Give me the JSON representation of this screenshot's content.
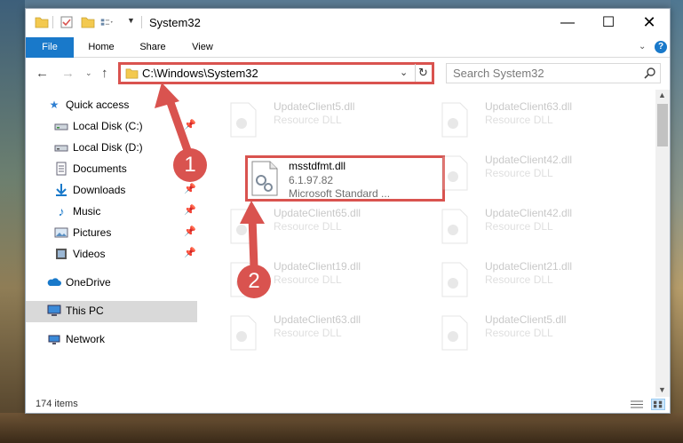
{
  "window": {
    "title": "System32",
    "controls": {
      "minimize": "—",
      "maximize": "☐",
      "close": "✕"
    }
  },
  "ribbon": {
    "tabs": [
      "File",
      "Home",
      "Share",
      "View"
    ],
    "help": "?"
  },
  "address_bar": {
    "path": "C:\\Windows\\System32",
    "dropdown": "⌄",
    "refresh": "↻"
  },
  "search": {
    "placeholder": "Search System32",
    "icon": "search-icon"
  },
  "sidebar": {
    "quick_access": "Quick access",
    "items": [
      {
        "label": "Local Disk (C:)",
        "icon": "drive-icon",
        "pinned": true
      },
      {
        "label": "Local Disk (D:)",
        "icon": "drive-icon",
        "pinned": false
      },
      {
        "label": "Documents",
        "icon": "documents-icon",
        "pinned": true
      },
      {
        "label": "Downloads",
        "icon": "download-icon",
        "pinned": true
      },
      {
        "label": "Music",
        "icon": "music-icon",
        "pinned": true
      },
      {
        "label": "Pictures",
        "icon": "pictures-icon",
        "pinned": true
      },
      {
        "label": "Videos",
        "icon": "videos-icon",
        "pinned": true
      }
    ],
    "onedrive": "OneDrive",
    "this_pc": "This PC",
    "network": "Network"
  },
  "files": {
    "highlighted": {
      "name": "msstdfmt.dll",
      "version": "6.1.97.82",
      "description": "Microsoft Standard ..."
    },
    "left_column": [
      {
        "name": "UpdateClient5.dll",
        "type": "Resource DLL"
      },
      {
        "name": "UpdateClient65.dll",
        "type": "Resource DLL"
      },
      {
        "name": "UpdateClient19.dll",
        "type": "Resource DLL"
      },
      {
        "name": "UpdateClient63.dll",
        "type": "Resource DLL"
      }
    ],
    "right_column": [
      {
        "name": "UpdateClient63.dll",
        "type": "Resource DLL"
      },
      {
        "name": "UpdateClient42.dll",
        "type": "Resource DLL"
      },
      {
        "name": "UpdateClient42.dll",
        "type": "Resource DLL"
      },
      {
        "name": "UpdateClient21.dll",
        "type": "Resource DLL"
      },
      {
        "name": "UpdateClient5.dll",
        "type": "Resource DLL"
      }
    ]
  },
  "status": {
    "item_count": "174 items"
  },
  "annotations": {
    "step1": "1",
    "step2": "2",
    "color": "#d9534f"
  }
}
